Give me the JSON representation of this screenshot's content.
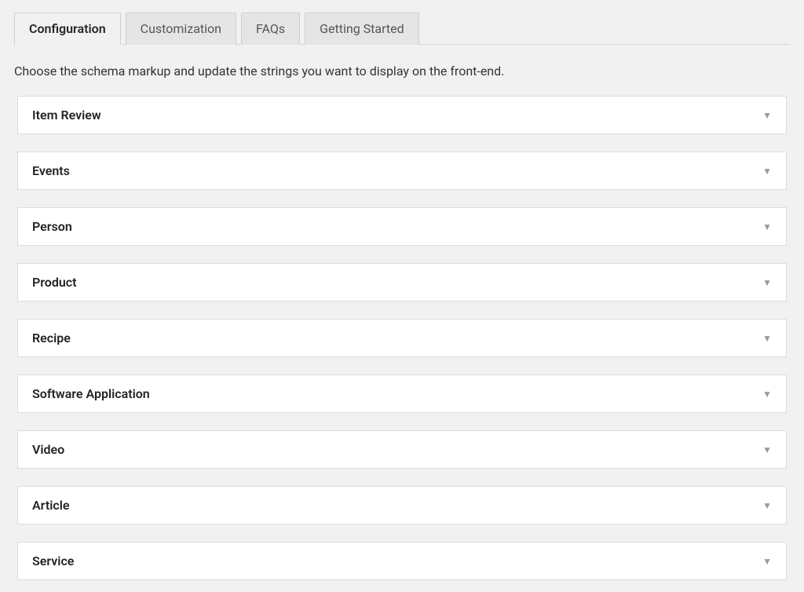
{
  "tabs": [
    {
      "label": "Configuration",
      "active": true
    },
    {
      "label": "Customization",
      "active": false
    },
    {
      "label": "FAQs",
      "active": false
    },
    {
      "label": "Getting Started",
      "active": false
    }
  ],
  "description": "Choose the schema markup and update the strings you want to display on the front-end.",
  "accordion": [
    {
      "label": "Item Review"
    },
    {
      "label": "Events"
    },
    {
      "label": "Person"
    },
    {
      "label": "Product"
    },
    {
      "label": "Recipe"
    },
    {
      "label": "Software Application"
    },
    {
      "label": "Video"
    },
    {
      "label": "Article"
    },
    {
      "label": "Service"
    }
  ]
}
